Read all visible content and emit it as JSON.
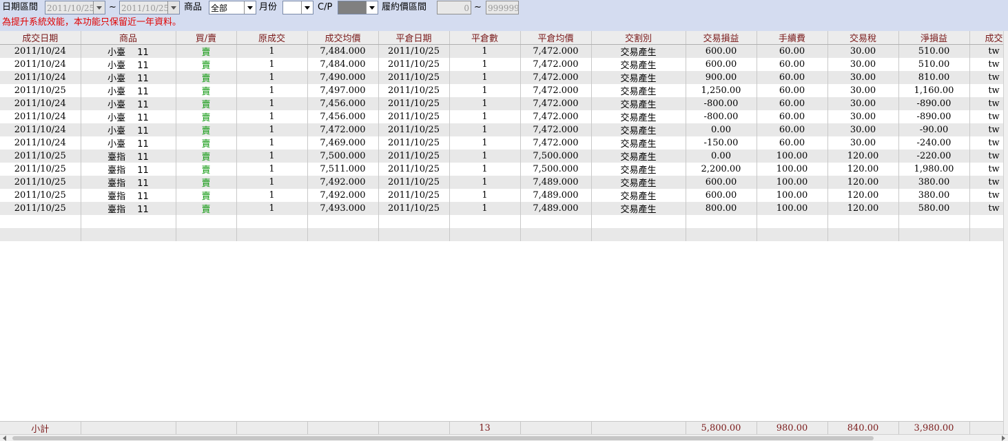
{
  "filters": {
    "date_range_label": "日期區間",
    "start_date": "2011/10/25",
    "tilde": "~",
    "end_date": "2011/10/25",
    "product_label": "商品",
    "product_value": "全部",
    "month_label": "月份",
    "month_value": "",
    "cp_label": "C/P",
    "cp_value": "",
    "strike_range_label": "履約價區間",
    "strike_min": "0",
    "strike_max": "999999"
  },
  "notice": "為提升系統效能，本功能只保留近一年資料。",
  "table": {
    "headers": [
      "成交日期",
      "商品",
      "買/賣",
      "原成交",
      "成交均價",
      "平倉日期",
      "平倉數",
      "平倉均價",
      "交割別",
      "交易損益",
      "手續費",
      "交易稅",
      "淨損益",
      "成交"
    ],
    "rows": [
      [
        "2011/10/24",
        "小臺　 11",
        "賣",
        "1",
        "7,484.000",
        "2011/10/25",
        "1",
        "7,472.000",
        "交易產生",
        "600.00",
        "60.00",
        "30.00",
        "510.00",
        "tw"
      ],
      [
        "2011/10/24",
        "小臺　 11",
        "賣",
        "1",
        "7,484.000",
        "2011/10/25",
        "1",
        "7,472.000",
        "交易產生",
        "600.00",
        "60.00",
        "30.00",
        "510.00",
        "tw"
      ],
      [
        "2011/10/24",
        "小臺　 11",
        "賣",
        "1",
        "7,490.000",
        "2011/10/25",
        "1",
        "7,472.000",
        "交易產生",
        "900.00",
        "60.00",
        "30.00",
        "810.00",
        "tw"
      ],
      [
        "2011/10/25",
        "小臺　 11",
        "賣",
        "1",
        "7,497.000",
        "2011/10/25",
        "1",
        "7,472.000",
        "交易產生",
        "1,250.00",
        "60.00",
        "30.00",
        "1,160.00",
        "tw"
      ],
      [
        "2011/10/24",
        "小臺　 11",
        "賣",
        "1",
        "7,456.000",
        "2011/10/25",
        "1",
        "7,472.000",
        "交易產生",
        "-800.00",
        "60.00",
        "30.00",
        "-890.00",
        "tw"
      ],
      [
        "2011/10/24",
        "小臺　 11",
        "賣",
        "1",
        "7,456.000",
        "2011/10/25",
        "1",
        "7,472.000",
        "交易產生",
        "-800.00",
        "60.00",
        "30.00",
        "-890.00",
        "tw"
      ],
      [
        "2011/10/24",
        "小臺　 11",
        "賣",
        "1",
        "7,472.000",
        "2011/10/25",
        "1",
        "7,472.000",
        "交易產生",
        "0.00",
        "60.00",
        "30.00",
        "-90.00",
        "tw"
      ],
      [
        "2011/10/24",
        "小臺　 11",
        "賣",
        "1",
        "7,469.000",
        "2011/10/25",
        "1",
        "7,472.000",
        "交易產生",
        "-150.00",
        "60.00",
        "30.00",
        "-240.00",
        "tw"
      ],
      [
        "2011/10/25",
        "臺指　 11",
        "賣",
        "1",
        "7,500.000",
        "2011/10/25",
        "1",
        "7,500.000",
        "交易產生",
        "0.00",
        "100.00",
        "120.00",
        "-220.00",
        "tw"
      ],
      [
        "2011/10/25",
        "臺指　 11",
        "賣",
        "1",
        "7,511.000",
        "2011/10/25",
        "1",
        "7,500.000",
        "交易產生",
        "2,200.00",
        "100.00",
        "120.00",
        "1,980.00",
        "tw"
      ],
      [
        "2011/10/25",
        "臺指　 11",
        "賣",
        "1",
        "7,492.000",
        "2011/10/25",
        "1",
        "7,489.000",
        "交易產生",
        "600.00",
        "100.00",
        "120.00",
        "380.00",
        "tw"
      ],
      [
        "2011/10/25",
        "臺指　 11",
        "賣",
        "1",
        "7,492.000",
        "2011/10/25",
        "1",
        "7,489.000",
        "交易產生",
        "600.00",
        "100.00",
        "120.00",
        "380.00",
        "tw"
      ],
      [
        "2011/10/25",
        "臺指　 11",
        "賣",
        "1",
        "7,493.000",
        "2011/10/25",
        "1",
        "7,489.000",
        "交易產生",
        "800.00",
        "100.00",
        "120.00",
        "580.00",
        "tw"
      ]
    ],
    "blank_rows": 2
  },
  "footer": {
    "cells": [
      "小計",
      "",
      "",
      "",
      "",
      "",
      "13",
      "",
      "",
      "5,800.00",
      "980.00",
      "840.00",
      "3,980.00",
      ""
    ]
  },
  "colors": {
    "toolbar_bg": "#d4dcf0",
    "notice_text": "#e00000",
    "header_text": "#7a1a1a",
    "sell_text": "#119911",
    "row_alt_bg": "#e8e8e8"
  }
}
